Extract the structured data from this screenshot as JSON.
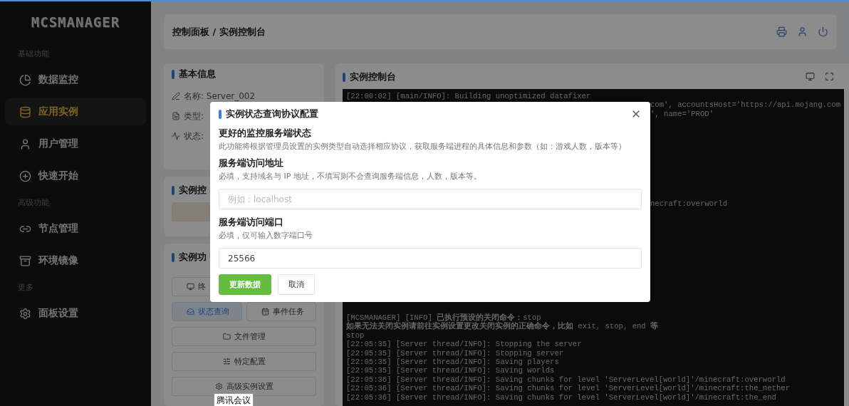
{
  "logo": "MCSMANAGER",
  "sidebar": {
    "groups": [
      {
        "title": "基础功能",
        "items": [
          {
            "label": "数据监控",
            "selected": false
          },
          {
            "label": "应用实例",
            "selected": true
          },
          {
            "label": "用户管理",
            "selected": false
          },
          {
            "label": "快速开始",
            "selected": false
          }
        ]
      },
      {
        "title": "高级功能",
        "items": [
          {
            "label": "节点管理",
            "selected": false
          },
          {
            "label": "环境镜像",
            "selected": false
          }
        ]
      },
      {
        "title": "更多",
        "items": [
          {
            "label": "面板设置",
            "selected": false
          }
        ]
      }
    ]
  },
  "header": {
    "breadcrumb": "控制面板 / 实例控制台"
  },
  "basic_info": {
    "title": "基本信息",
    "rows": [
      {
        "text": "名称: Server_002"
      },
      {
        "text": "类型:"
      },
      {
        "text": "状态:"
      }
    ]
  },
  "control": {
    "title": "实例控"
  },
  "functions": {
    "title": "实例功",
    "buttons": [
      {
        "label": "终",
        "wide": false,
        "selected": false
      },
      {
        "label": "状态查询",
        "wide": false,
        "selected": true
      },
      {
        "label": "事件任务",
        "wide": false,
        "selected": false
      },
      {
        "label": "文件管理",
        "wide": true,
        "selected": false
      },
      {
        "label": "特定配置",
        "wide": true,
        "selected": false
      },
      {
        "label": "高级实例设置",
        "wide": true,
        "selected": false
      }
    ]
  },
  "console": {
    "title": "实例控制台",
    "lines": [
      {
        "kind": "full",
        "text": "[22:00:02] [main/INFO]: Building unoptimized datafixer"
      },
      {
        "kind": "tail",
        "text": "com', accountsHost='https://api.mojang.com"
      },
      {
        "kind": "tail",
        "text": "', name='PROD'"
      },
      {
        "kind": "tail",
        "text": "necraft:overworld"
      },
      {
        "kind": "full",
        "text": "[MCSMANAGER] [INFO] **已执行预设的关闭命令：**stop"
      },
      {
        "kind": "full",
        "text": "**如果无法关闭实例请前往实例设置更改关闭实例的正确命令，比如** exit, stop, end **等**"
      },
      {
        "kind": "full",
        "text": "stop"
      },
      {
        "kind": "full",
        "text": "[22:05:35] [Server thread/INFO]: Stopping the server"
      },
      {
        "kind": "full",
        "text": "[22:05:35] [Server thread/INFO]: Stopping server"
      },
      {
        "kind": "full",
        "text": "[22:05:35] [Server thread/INFO]: Saving players"
      },
      {
        "kind": "full",
        "text": "[22:05:35] [Server thread/INFO]: Saving worlds"
      },
      {
        "kind": "full",
        "text": "[22:05:36] [Server thread/INFO]: Saving chunks for level 'ServerLevel[world]'/minecraft:overworld"
      },
      {
        "kind": "full",
        "text": "[22:05:36] [Server thread/INFO]: Saving chunks for level 'ServerLevel[world]'/minecraft:the_nether"
      },
      {
        "kind": "full",
        "text": "[22:05:36] [Server thread/INFO]: Saving chunks for level 'ServerLevel[world]'/minecraft:the_end"
      }
    ]
  },
  "modal": {
    "title": "实例状态查询协议配置",
    "sections": [
      {
        "heading": "更好的监控服务端状态",
        "hint": "此功能将根据管理员设置的实例类型自动选择相应协议，获取服务端进程的具体信息和参数（如：游戏人数，版本等）"
      },
      {
        "heading": "服务端访问地址",
        "hint": "必填，支持域名与 IP 地址，不填写则不会查询服务端信息，人数，版本等。",
        "placeholder": "例如：localhost"
      },
      {
        "heading": "服务端访问端口",
        "hint": "必填，仅可输入数字端口号",
        "value": "25566"
      }
    ],
    "buttons": [
      {
        "label": "更新数据",
        "kind": "primary"
      },
      {
        "label": "取消",
        "kind": "default"
      }
    ]
  },
  "tooltip": "腾讯会议"
}
